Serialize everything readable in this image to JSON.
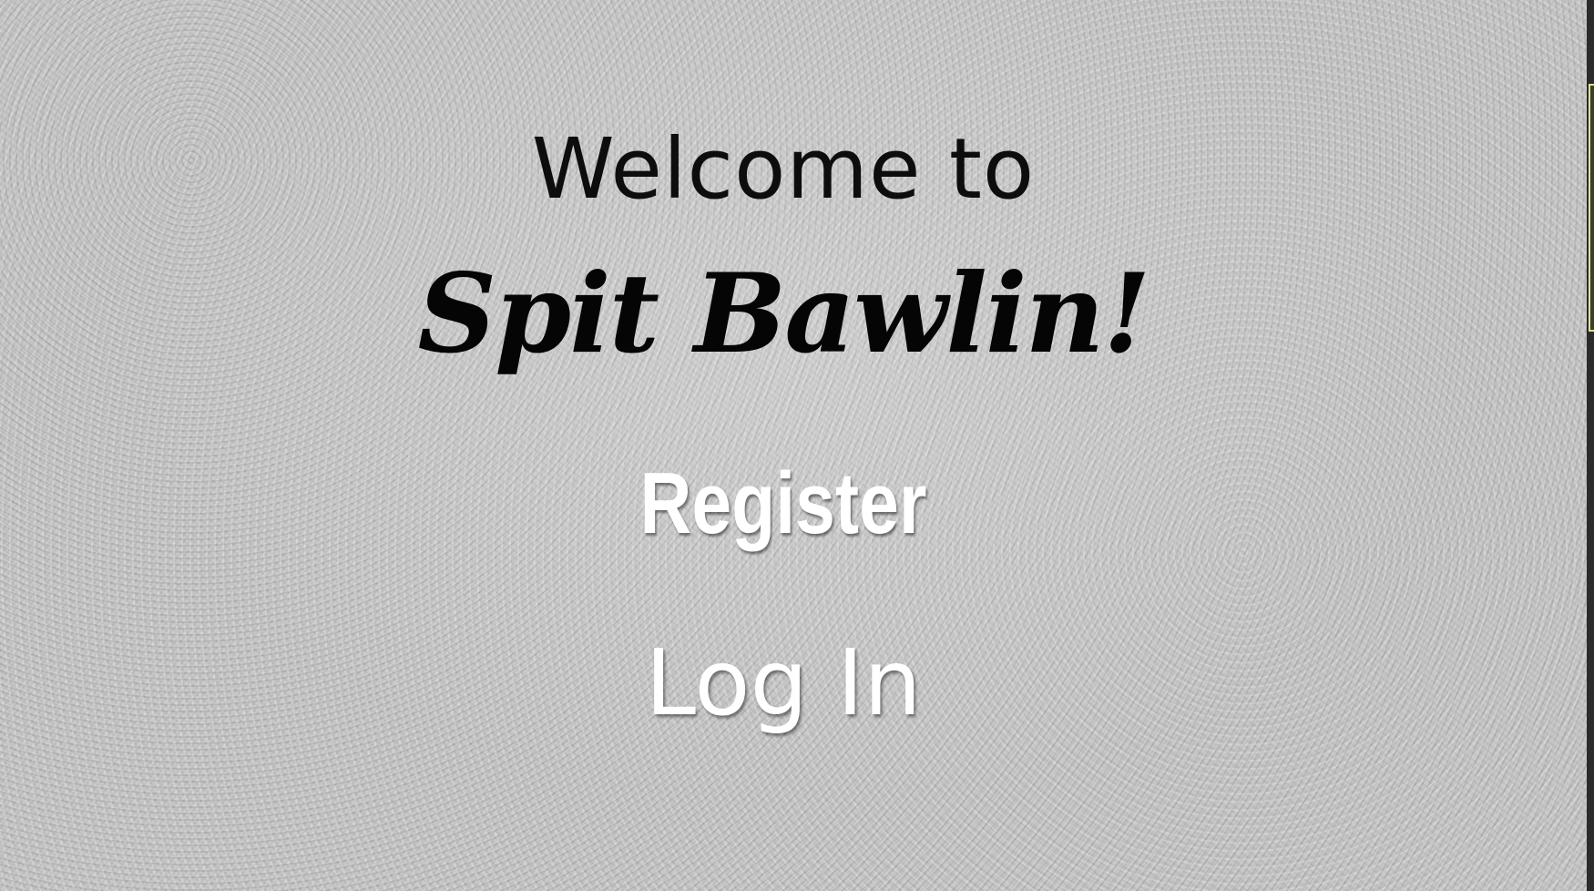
{
  "welcome": {
    "greeting": "Welcome to",
    "brand": "Spit Bawlin!"
  },
  "actions": {
    "register_label": "Register",
    "login_label": "Log In"
  },
  "colors": {
    "background": "#c9c9c9",
    "heading_text": "#0d0d0d",
    "action_text": "#ffffff"
  }
}
